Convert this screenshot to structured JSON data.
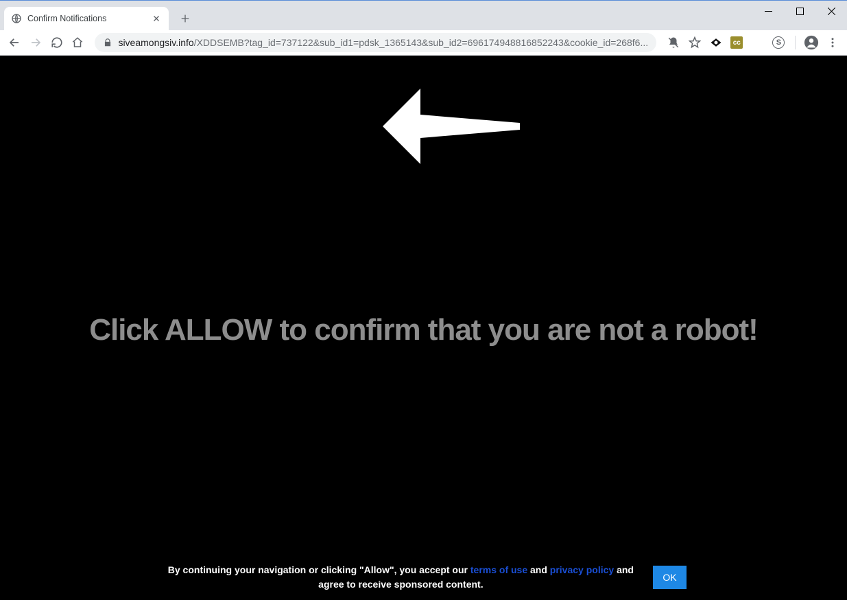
{
  "tab": {
    "title": "Confirm Notifications"
  },
  "url": {
    "host": "siveamongsiv.info",
    "path": "/XDDSEMB?tag_id=737122&sub_id1=pdsk_1365143&sub_id2=696174948816852243&cookie_id=268f6..."
  },
  "extensions": {
    "cc_label": "cc",
    "s_label": "S"
  },
  "page": {
    "headline": "Click ALLOW to confirm that you are not a robot!",
    "footer_prefix": "By continuing your navigation or clicking \"Allow\", you accept our ",
    "terms_label": "terms of use",
    "and_label": " and ",
    "privacy_label": "privacy policy",
    "footer_suffix": " and agree to receive sponsored content.",
    "ok_label": "OK"
  }
}
